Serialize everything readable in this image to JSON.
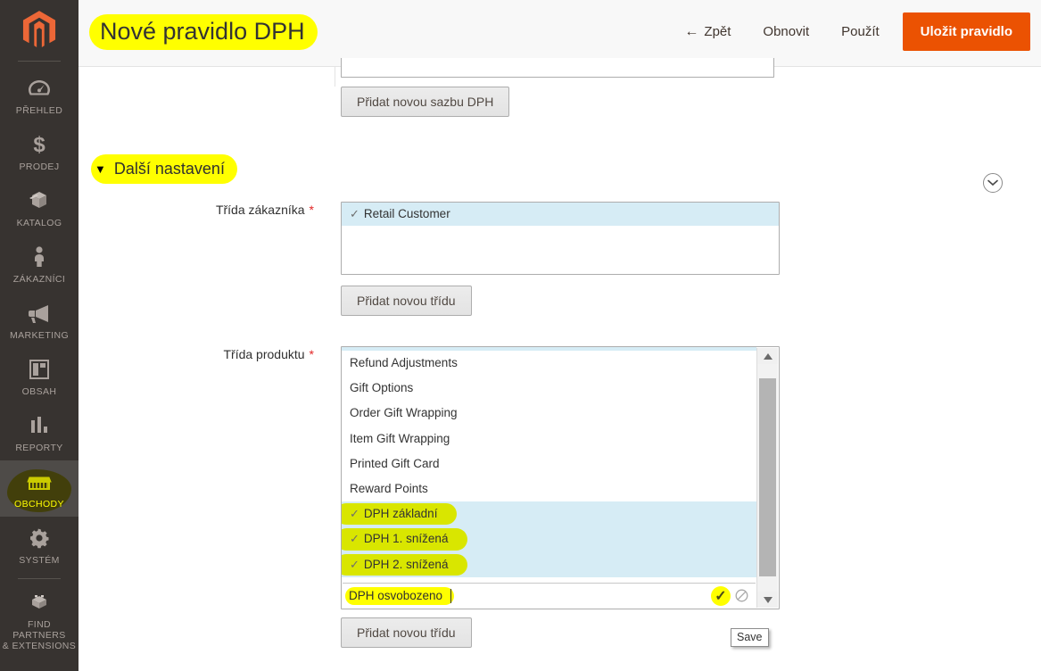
{
  "sidebar": {
    "logo_name": "magento-logo",
    "items": [
      {
        "label": "PŘEHLED",
        "icon": "dashboard-icon",
        "active": false
      },
      {
        "label": "PRODEJ",
        "icon": "dollar-icon",
        "active": false
      },
      {
        "label": "KATALOG",
        "icon": "box-icon",
        "active": false
      },
      {
        "label": "ZÁKAZNÍCI",
        "icon": "person-icon",
        "active": false
      },
      {
        "label": "MARKETING",
        "icon": "megaphone-icon",
        "active": false
      },
      {
        "label": "OBSAH",
        "icon": "layout-icon",
        "active": false
      },
      {
        "label": "REPORTY",
        "icon": "bar-chart-icon",
        "active": false
      },
      {
        "label": "OBCHODY",
        "icon": "store-icon",
        "active": true
      },
      {
        "label": "SYSTÉM",
        "icon": "gear-icon",
        "active": false
      },
      {
        "label": "FIND PARTNERS\n& EXTENSIONS",
        "icon": "bricks-icon",
        "active": false
      }
    ],
    "find_partners_line1": "FIND PARTNERS",
    "find_partners_line2": "& EXTENSIONS"
  },
  "header": {
    "title": "Nové pravidlo DPH",
    "back_label": "Zpět",
    "back_arrow": "←",
    "refresh_label": "Obnovit",
    "apply_label": "Použít",
    "save_label": "Uložit pravidlo",
    "accent_color": "#eb5202",
    "highlight_color": "#ffff00"
  },
  "content": {
    "add_rate_button": "Přidat novou sazbu DPH",
    "section_title": "Další nastavení",
    "section_caret": "▼",
    "collapse_icon": "chevron-down-circle-icon",
    "customer_class": {
      "label": "Třída zákazníka",
      "required_marker": "*",
      "options": [
        {
          "label": "Retail Customer",
          "selected": true,
          "check": "✓"
        }
      ],
      "add_button": "Přidat novou třídu"
    },
    "product_class": {
      "label": "Třída produktu",
      "required_marker": "*",
      "options": [
        {
          "label": "Refund Adjustments",
          "selected": false,
          "marked": false,
          "check": ""
        },
        {
          "label": "Gift Options",
          "selected": false,
          "marked": false,
          "check": ""
        },
        {
          "label": "Order Gift Wrapping",
          "selected": false,
          "marked": false,
          "check": ""
        },
        {
          "label": "Item Gift Wrapping",
          "selected": false,
          "marked": false,
          "check": ""
        },
        {
          "label": "Printed Gift Card",
          "selected": false,
          "marked": false,
          "check": ""
        },
        {
          "label": "Reward Points",
          "selected": false,
          "marked": false,
          "check": ""
        },
        {
          "label": "DPH základní",
          "selected": true,
          "marked": true,
          "check": "✓"
        },
        {
          "label": "DPH 1. snížená",
          "selected": true,
          "marked": true,
          "check": "✓"
        },
        {
          "label": "DPH 2. snížená",
          "selected": true,
          "marked": true,
          "check": "✓"
        }
      ],
      "edit_row": {
        "value": "DPH osvobozeno",
        "placeholder": "",
        "confirm_icon": "check-icon",
        "cancel_icon": "no-entry-icon"
      },
      "add_button": "Přidat novou třídu",
      "selected_row_color": "#d6ecf5",
      "highlight_color": "#d9e600"
    },
    "tooltip": "Save"
  }
}
